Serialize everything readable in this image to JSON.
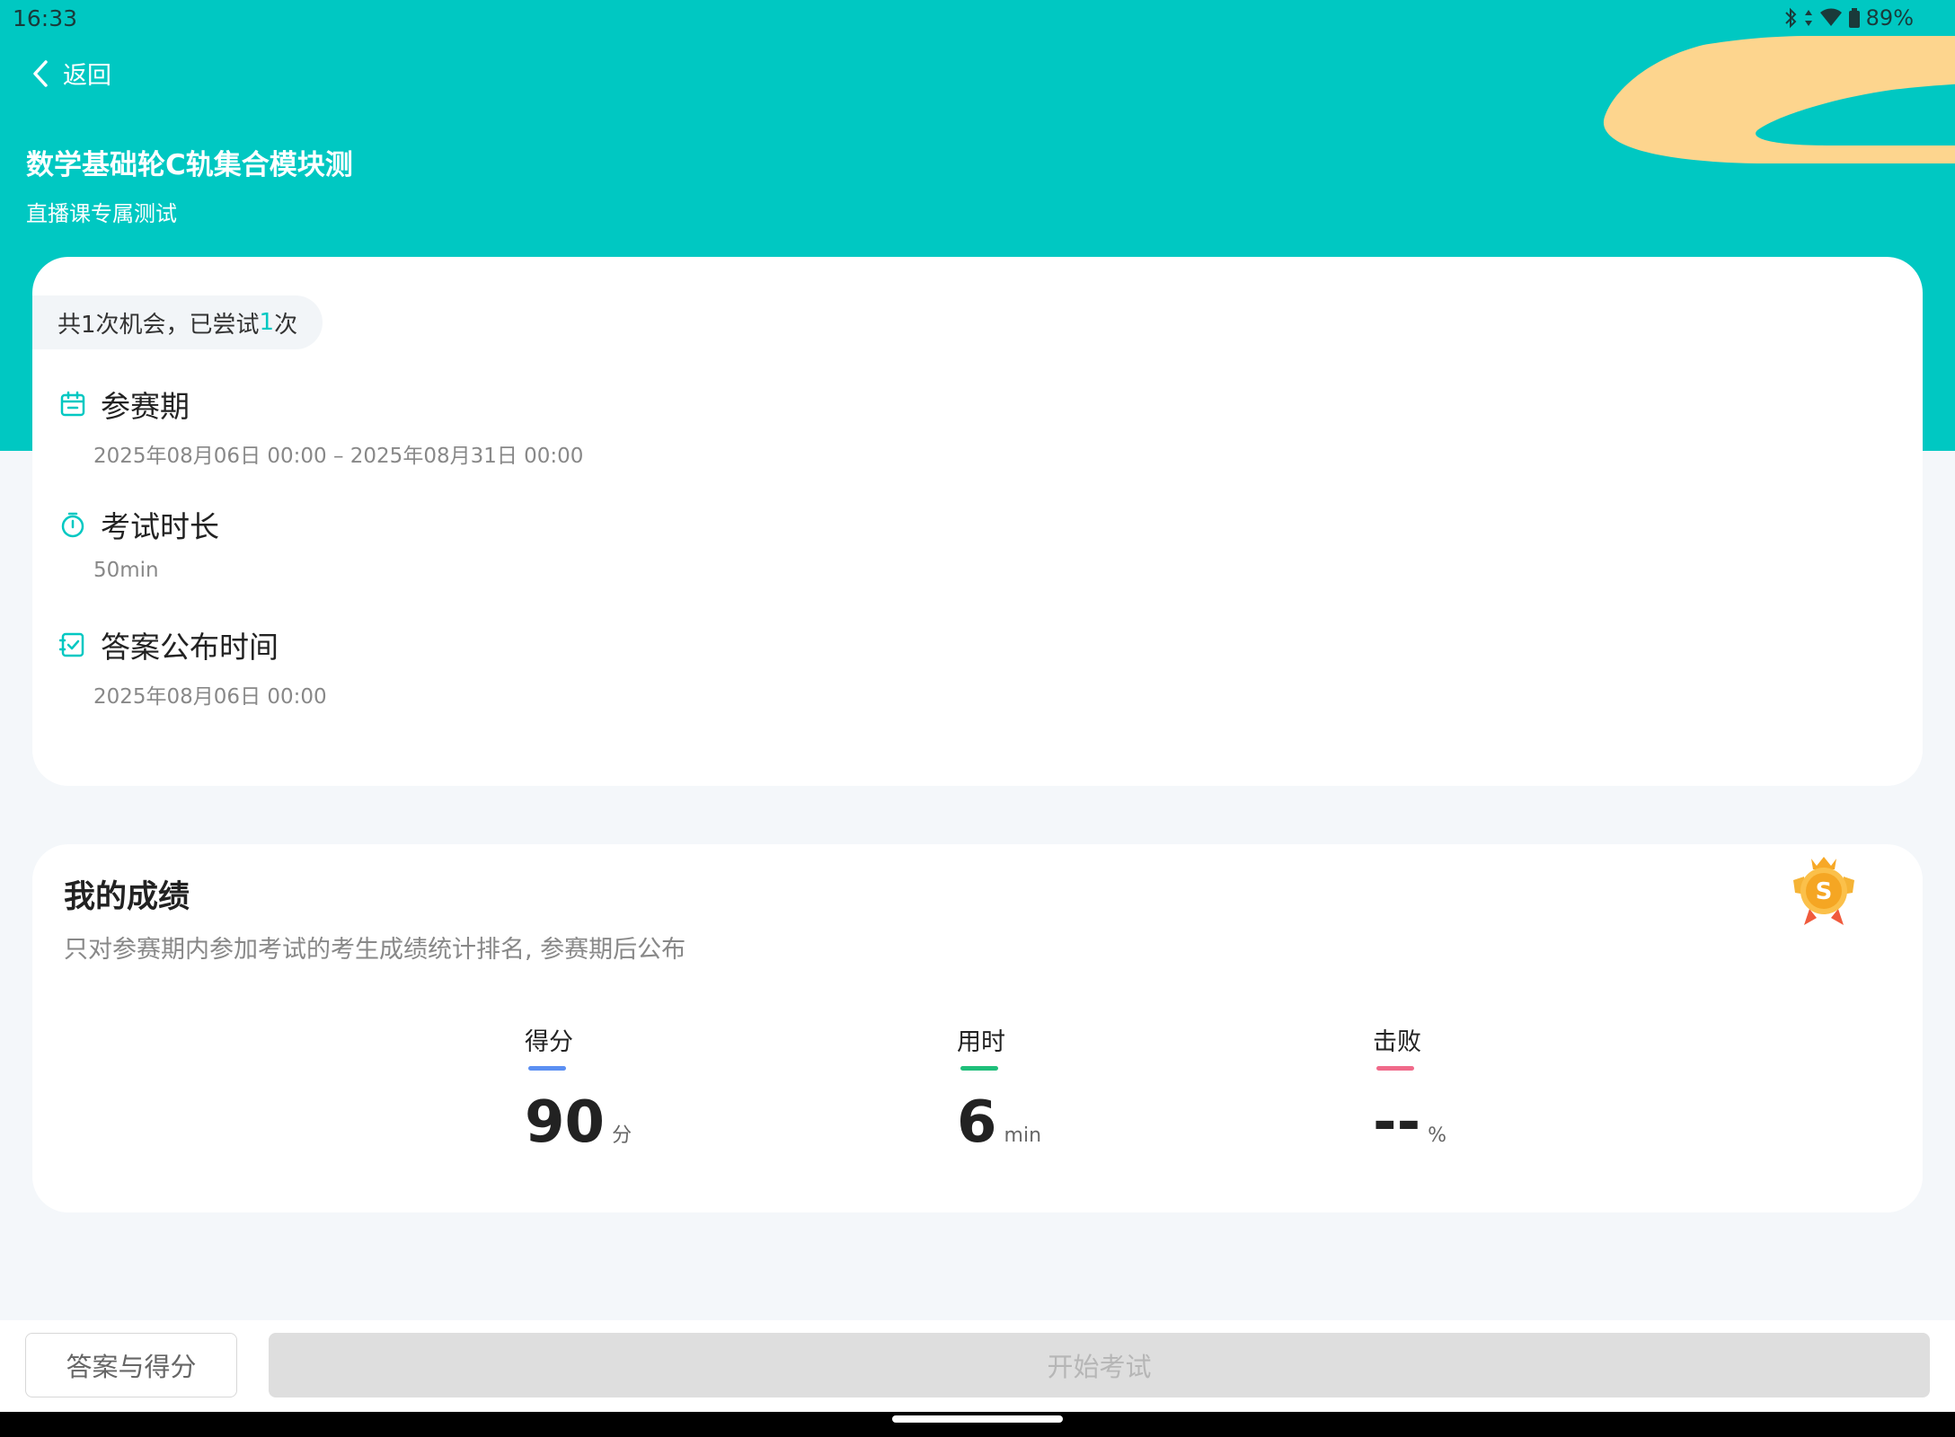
{
  "status_bar": {
    "time": "16:33",
    "battery": "89%",
    "icons": [
      "bluetooth-icon",
      "data-arrows-icon",
      "wifi-icon",
      "battery-icon"
    ]
  },
  "header": {
    "back_label": "返回",
    "title": "数学基础轮C轨集合模块测",
    "subtitle": "直播课专属测试",
    "background_color": "#00c8c2",
    "decoration_color": "#fdd58e"
  },
  "info_card": {
    "attempts_prefix": "共1次机会，已尝试",
    "attempts_count": "1",
    "attempts_suffix": "次",
    "rows": [
      {
        "icon": "calendar-icon",
        "label": "参赛期",
        "value": "2025年08月06日 00:00  –  2025年08月31日 00:00"
      },
      {
        "icon": "stopwatch-icon",
        "label": "考试时长",
        "value": "50min"
      },
      {
        "icon": "checklist-icon",
        "label": "答案公布时间",
        "value": "2025年08月06日 00:00"
      }
    ],
    "accent_color": "#00c8c2"
  },
  "score_card": {
    "title": "我的成绩",
    "description": "只对参赛期内参加考试的考生成绩统计排名, 参赛期后公布",
    "badge_icon": "medal-icon",
    "badge_letter": "S",
    "stats": [
      {
        "label": "得分",
        "value": "90",
        "unit": "分",
        "bar_color": "#5b8ff2"
      },
      {
        "label": "用时",
        "value": "6",
        "unit": "min",
        "bar_color": "#1fbf7a"
      },
      {
        "label": "击败",
        "value": "--",
        "unit": "%",
        "bar_color": "#f06a8a"
      }
    ]
  },
  "bottom_bar": {
    "answers_button": "答案与得分",
    "start_button": "开始考试"
  }
}
